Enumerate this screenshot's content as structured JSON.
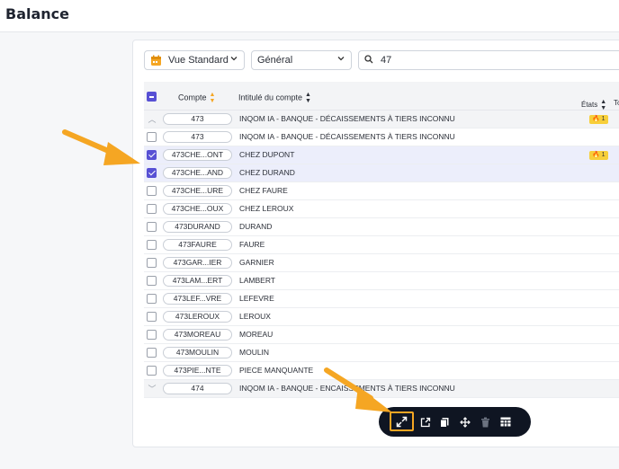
{
  "page": {
    "title": "Balance"
  },
  "filters": {
    "view_label": "Vue Standard",
    "general_label": "Général",
    "search_value": "47"
  },
  "table": {
    "headers": {
      "compte": "Compte",
      "intitule": "Intitulé du compte",
      "etats": "États",
      "to": "To"
    },
    "rows": [
      {
        "type": "group",
        "code": "473",
        "title": "INQOM IA - BANQUE - DÉCAISSEMENTS À TIERS INCONNU",
        "badge": "🔥 1",
        "checked": false,
        "caret": "up"
      },
      {
        "type": "row",
        "code": "473",
        "title": "INQOM IA - BANQUE - DÉCAISSEMENTS À TIERS INCONNU",
        "checked": false
      },
      {
        "type": "row",
        "code": "473CHE...ONT",
        "title": "CHEZ DUPONT",
        "badge": "🔥 1",
        "checked": true
      },
      {
        "type": "row",
        "code": "473CHE...AND",
        "title": "CHEZ DURAND",
        "checked": true
      },
      {
        "type": "row",
        "code": "473CHE...URE",
        "title": "CHEZ FAURE",
        "checked": false
      },
      {
        "type": "row",
        "code": "473CHE...OUX",
        "title": "CHEZ LEROUX",
        "checked": false
      },
      {
        "type": "row",
        "code": "473DURAND",
        "title": "DURAND",
        "checked": false
      },
      {
        "type": "row",
        "code": "473FAURE",
        "title": "FAURE",
        "checked": false
      },
      {
        "type": "row",
        "code": "473GAR...IER",
        "title": "GARNIER",
        "checked": false
      },
      {
        "type": "row",
        "code": "473LAM...ERT",
        "title": "LAMBERT",
        "checked": false
      },
      {
        "type": "row",
        "code": "473LEF...VRE",
        "title": "LEFEVRE",
        "checked": false
      },
      {
        "type": "row",
        "code": "473LEROUX",
        "title": "LEROUX",
        "checked": false
      },
      {
        "type": "row",
        "code": "473MOREAU",
        "title": "MOREAU",
        "checked": false
      },
      {
        "type": "row",
        "code": "473MOULIN",
        "title": "MOULIN",
        "checked": false
      },
      {
        "type": "row",
        "code": "473PIE...NTE",
        "title": "PIECE MANQUANTE",
        "checked": false
      },
      {
        "type": "group",
        "code": "474",
        "title": "INQOM IA - BANQUE - ENCAISSEMENTS À TIERS INCONNU",
        "checked": false,
        "caret": "down"
      }
    ]
  },
  "toolbar": {
    "buttons": [
      {
        "name": "expand-icon",
        "highlighted": true
      },
      {
        "name": "export-icon"
      },
      {
        "name": "copy-icon"
      },
      {
        "name": "move-icon"
      },
      {
        "name": "trash-icon",
        "disabled": true
      },
      {
        "name": "table-icon"
      }
    ]
  },
  "colors": {
    "accent": "#5750d4",
    "highlight": "#f5a623",
    "toolbar_bg": "#0f1522",
    "badge": "#f7cf3a"
  }
}
